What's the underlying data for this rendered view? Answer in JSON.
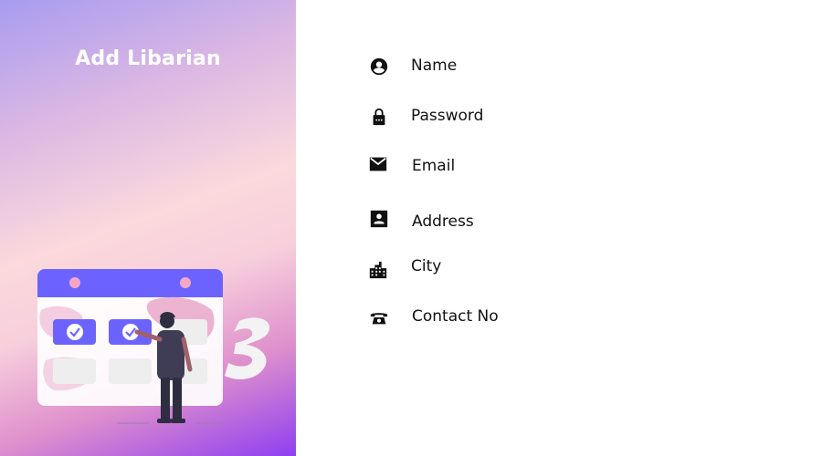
{
  "header": {
    "title": "Add Libarian"
  },
  "form": {
    "fields": [
      {
        "label": "Name",
        "icon": "account-circle-icon"
      },
      {
        "label": "Password",
        "icon": "lock-icon"
      },
      {
        "label": "Email",
        "icon": "mail-icon"
      },
      {
        "label": "Address",
        "icon": "contact-card-icon"
      },
      {
        "label": "City",
        "icon": "city-buildings-icon"
      },
      {
        "label": "Contact No",
        "icon": "phone-icon"
      }
    ]
  },
  "colors": {
    "accent": "#6c63ff",
    "gradient_top": "#a79cf0",
    "gradient_mid": "#fbd9dc",
    "gradient_bottom": "#8f3ff0"
  }
}
